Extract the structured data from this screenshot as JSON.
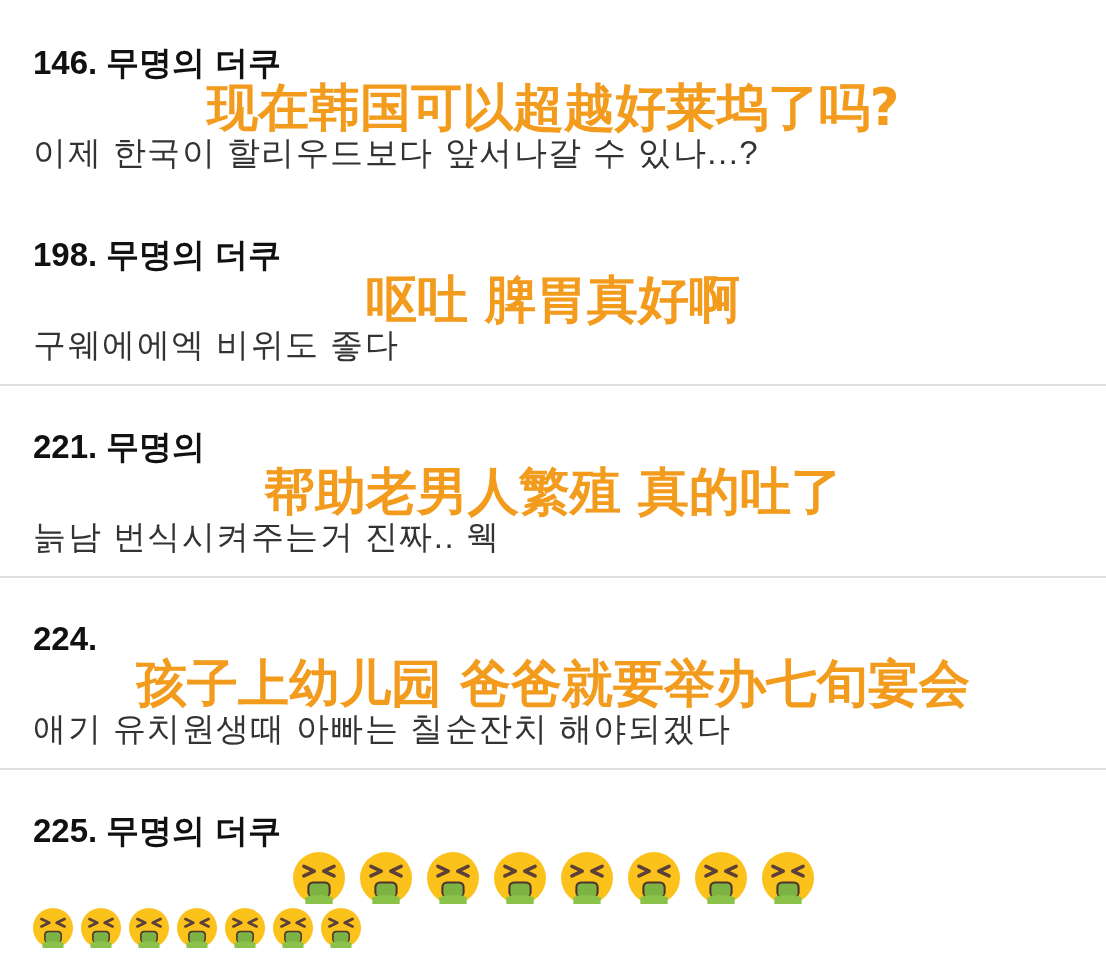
{
  "comments": [
    {
      "number": "146.",
      "author": "무명의 더쿠",
      "divider_above": false,
      "caption": "现在韩国可以超越好莱坞了吗?",
      "body": "이제 한국이 할리우드보다 앞서나갈 수 있나...?"
    },
    {
      "number": "198.",
      "author": "무명의 더쿠",
      "divider_above": false,
      "caption": "呕吐 脾胃真好啊",
      "body": "구웨에에엑 비위도 좋다"
    },
    {
      "number": "221.",
      "author": "무명의",
      "divider_above": true,
      "caption": "帮助老男人繁殖 真的吐了",
      "body": "늙남 번식시켜주는거 진짜.. 웩"
    },
    {
      "number": "224.",
      "divider_above": true,
      "caption": "孩子上幼儿园 爸爸就要举办七旬宴会",
      "body": "애기 유치원생때 아빠는 칠순잔치 해야되겠다"
    },
    {
      "number": "225.",
      "author": "무명의 더쿠",
      "divider_above": true,
      "overlay_emojis": [
        {
          "kind": "vomiting"
        },
        {
          "kind": "vomiting"
        },
        {
          "kind": "vomiting"
        },
        {
          "kind": "vomiting"
        },
        {
          "kind": "vomiting"
        },
        {
          "kind": "vomiting"
        },
        {
          "kind": "vomiting"
        },
        {
          "kind": "vomiting"
        }
      ],
      "body_emojis": [
        {
          "kind": "vomiting"
        },
        {
          "kind": "vomiting"
        },
        {
          "kind": "vomiting"
        },
        {
          "kind": "vomiting"
        },
        {
          "kind": "vomiting"
        },
        {
          "kind": "vomiting"
        },
        {
          "kind": "vomiting"
        }
      ]
    }
  ]
}
